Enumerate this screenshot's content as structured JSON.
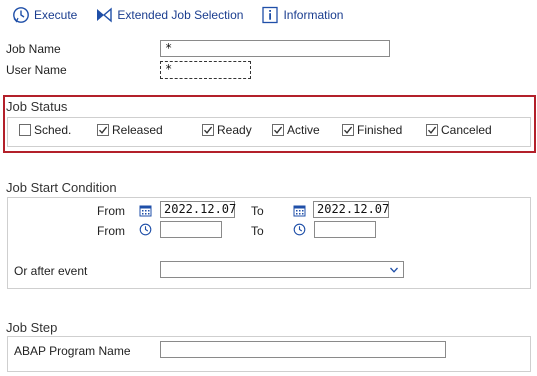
{
  "toolbar": {
    "execute_label": "Execute",
    "extended_label": "Extended Job Selection",
    "information_label": "Information"
  },
  "fields": {
    "job_name_label": "Job Name",
    "job_name_value": "*",
    "user_name_label": "User Name",
    "user_name_value": "*"
  },
  "job_status": {
    "title": "Job Status",
    "options": [
      {
        "label": "Sched.",
        "checked": false
      },
      {
        "label": "Released",
        "checked": true
      },
      {
        "label": "Ready",
        "checked": true
      },
      {
        "label": "Active",
        "checked": true
      },
      {
        "label": "Finished",
        "checked": true
      },
      {
        "label": "Canceled",
        "checked": true
      }
    ]
  },
  "start_condition": {
    "title": "Job Start Condition",
    "from_label": "From",
    "to_label": "To",
    "from_date": "2022.12.07",
    "to_date": "2022.12.07",
    "from_time": "",
    "to_time": "",
    "after_event_label": "Or after event",
    "after_event_value": ""
  },
  "job_step": {
    "title": "Job Step",
    "program_label": "ABAP Program Name",
    "program_value": ""
  },
  "colors": {
    "highlight_border": "#b3202a",
    "link_blue": "#1a3d8f",
    "icon_blue": "#1f4fa8"
  }
}
